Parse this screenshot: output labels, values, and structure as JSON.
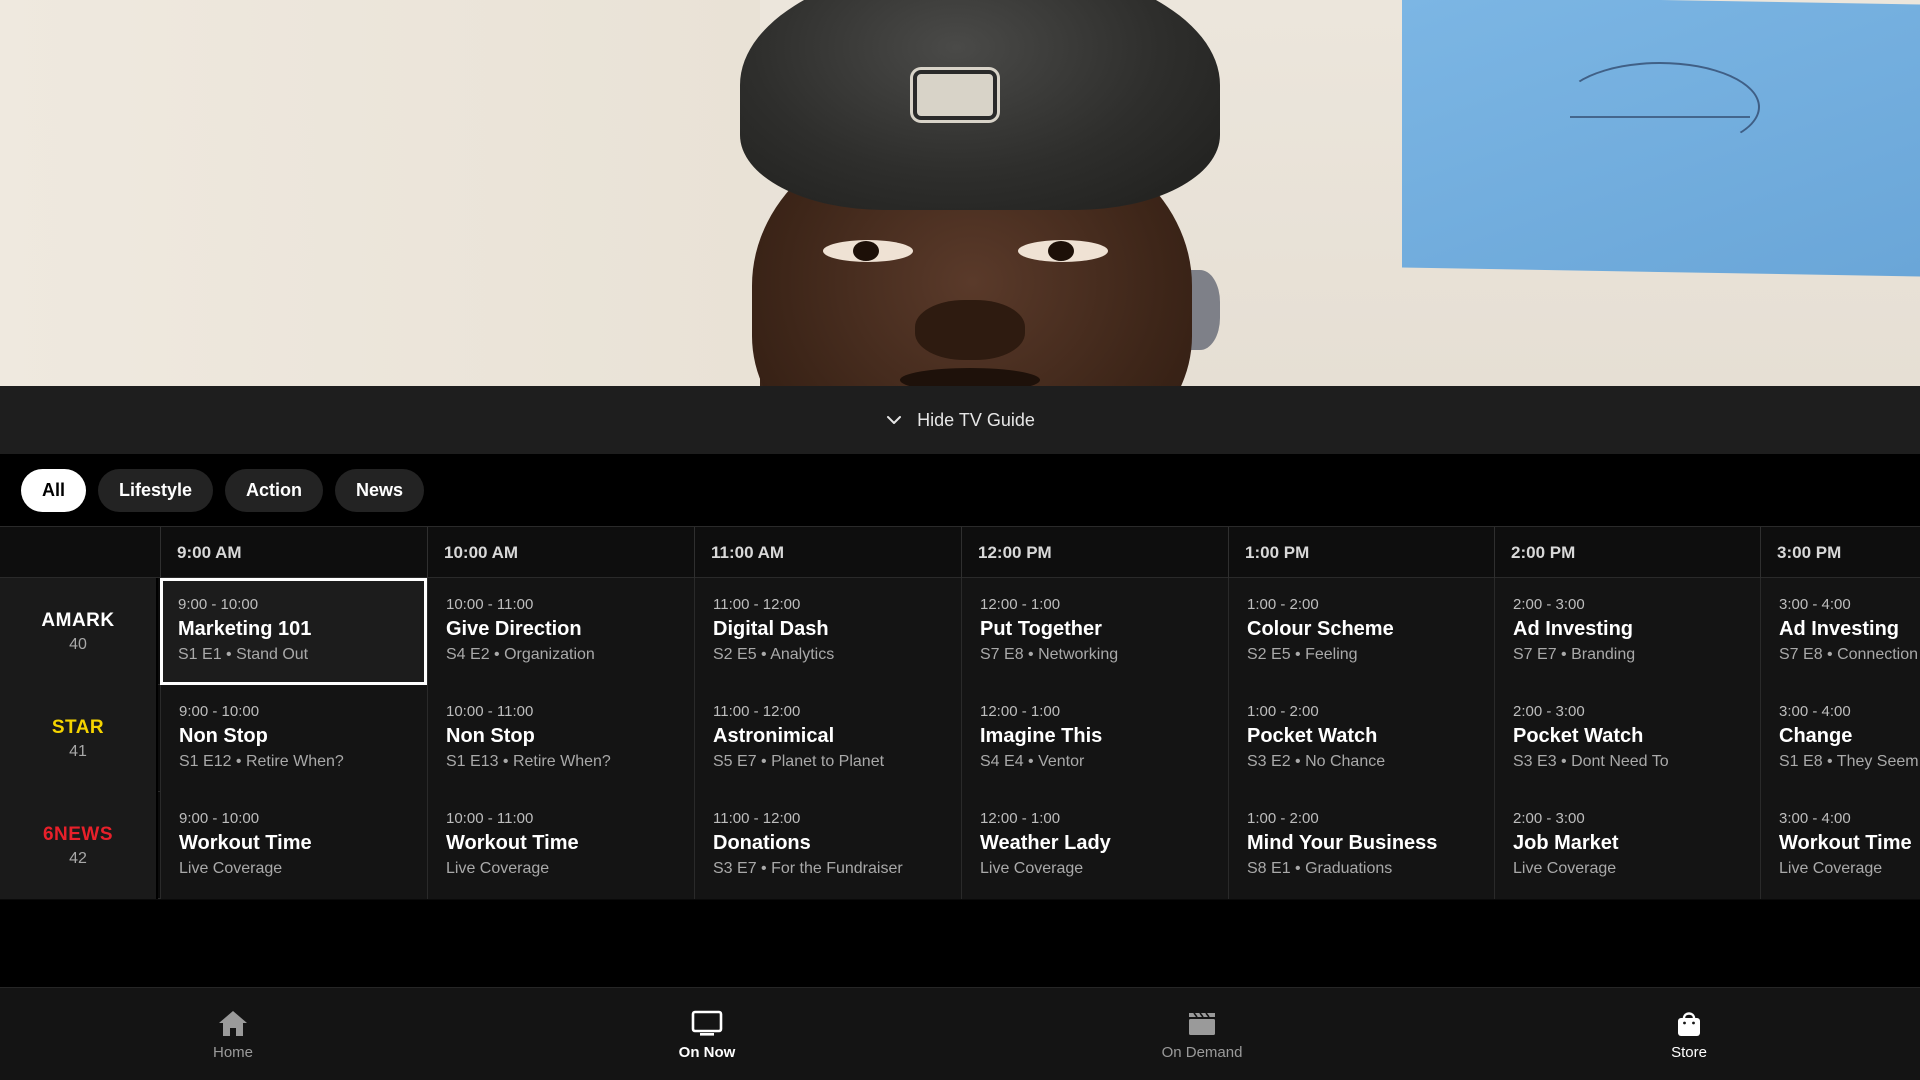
{
  "hide_guide": {
    "label": "Hide TV Guide",
    "icon": "chevron-down-icon"
  },
  "filters": [
    {
      "label": "All",
      "active": true
    },
    {
      "label": "Lifestyle",
      "active": false
    },
    {
      "label": "Action",
      "active": false
    },
    {
      "label": "News",
      "active": false
    }
  ],
  "times": [
    "9:00 AM",
    "10:00 AM",
    "11:00 AM",
    "12:00 PM",
    "1:00 PM",
    "2:00 PM",
    "3:00 PM"
  ],
  "channels": [
    {
      "name": "AMARK",
      "number": "40",
      "color": "#ffffff",
      "programs": [
        {
          "time": "9:00 - 10:00",
          "title": "Marketing 101",
          "sub": "S1 E1 • Stand Out",
          "selected": true
        },
        {
          "time": "10:00 - 11:00",
          "title": "Give Direction",
          "sub": "S4 E2 • Organization"
        },
        {
          "time": "11:00 - 12:00",
          "title": "Digital Dash",
          "sub": "S2 E5 • Analytics"
        },
        {
          "time": "12:00 - 1:00",
          "title": "Put Together",
          "sub": "S7 E8 • Networking"
        },
        {
          "time": "1:00 - 2:00",
          "title": "Colour Scheme",
          "sub": "S2 E5 • Feeling"
        },
        {
          "time": "2:00 - 3:00",
          "title": "Ad Investing",
          "sub": "S7 E7 • Branding"
        },
        {
          "time": "3:00 - 4:00",
          "title": "Ad Investing",
          "sub": "S7 E8 • Connection"
        }
      ]
    },
    {
      "name": "STAR",
      "number": "41",
      "color": "#f5d400",
      "programs": [
        {
          "time": "9:00 - 10:00",
          "title": "Non Stop",
          "sub": "S1 E12 • Retire When?"
        },
        {
          "time": "10:00 - 11:00",
          "title": "Non Stop",
          "sub": "S1 E13 • Retire When?"
        },
        {
          "time": "11:00 - 12:00",
          "title": "Astronimical",
          "sub": "S5 E7 • Planet to Planet"
        },
        {
          "time": "12:00 - 1:00",
          "title": "Imagine This",
          "sub": "S4 E4 • Ventor"
        },
        {
          "time": "1:00 - 2:00",
          "title": "Pocket Watch",
          "sub": "S3 E2 • No Chance"
        },
        {
          "time": "2:00 - 3:00",
          "title": "Pocket Watch",
          "sub": "S3 E3 • Dont Need To"
        },
        {
          "time": "3:00 - 4:00",
          "title": "Change",
          "sub": "S1 E8 • They Seem"
        }
      ]
    },
    {
      "name": "6NEWS",
      "number": "42",
      "color": "#e8202a",
      "programs": [
        {
          "time": "9:00 - 10:00",
          "title": "Workout Time",
          "sub": "Live Coverage"
        },
        {
          "time": "10:00 - 11:00",
          "title": "Workout Time",
          "sub": "Live Coverage"
        },
        {
          "time": "11:00 - 12:00",
          "title": "Donations",
          "sub": "S3 E7 • For the Fundraiser"
        },
        {
          "time": "12:00 - 1:00",
          "title": "Weather Lady",
          "sub": "Live Coverage"
        },
        {
          "time": "1:00 - 2:00",
          "title": "Mind Your Business",
          "sub": "S8 E1 • Graduations"
        },
        {
          "time": "2:00 - 3:00",
          "title": "Job Market",
          "sub": "Live Coverage"
        },
        {
          "time": "3:00 - 4:00",
          "title": "Workout Time",
          "sub": "Live Coverage"
        }
      ]
    }
  ],
  "nav": [
    {
      "label": "Home",
      "icon": "home-icon",
      "active": false
    },
    {
      "label": "On Now",
      "icon": "tv-icon",
      "active": true
    },
    {
      "label": "On Demand",
      "icon": "clapperboard-icon",
      "active": false
    },
    {
      "label": "Store",
      "icon": "shopping-bag-icon",
      "active": false
    }
  ]
}
